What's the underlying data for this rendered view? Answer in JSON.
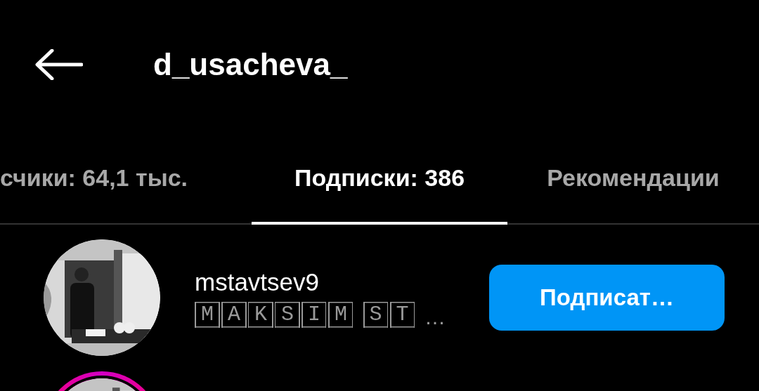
{
  "header": {
    "title": "d_usacheva_"
  },
  "tabs": [
    {
      "label": "счики: 64,1 тыс.",
      "selected": false
    },
    {
      "label": "Подписки: 386",
      "selected": true
    },
    {
      "label": "Рекомендации",
      "selected": false
    }
  ],
  "users": [
    {
      "username": "mstavtsev9",
      "full_name_words": [
        "MAKSIM",
        "ST"
      ],
      "full_name_end": "…",
      "button": "Подписат…",
      "has_story": false,
      "kind": "picture"
    },
    {
      "has_story": true,
      "kind": "picture"
    }
  ]
}
